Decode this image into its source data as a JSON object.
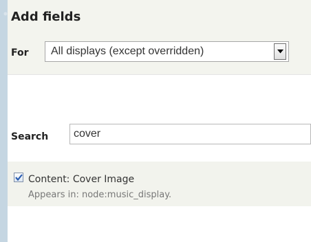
{
  "panel": {
    "title": "Add fields",
    "for_label": "For",
    "display_select": {
      "selected": "All displays (except overridden)"
    }
  },
  "search": {
    "label": "Search",
    "value": "cover"
  },
  "results": [
    {
      "label": "Content: Cover Image",
      "description": "Appears in: node:music_display.",
      "checked": true
    }
  ],
  "colors": {
    "page_background": "#c5d6e2",
    "header_background": "#f3f4ee",
    "result_background": "#f2f3ed",
    "checkmark": "#2a5db0"
  },
  "icons": {
    "select_arrow": "chevron-down-icon",
    "checkbox": "checkmark-icon"
  }
}
